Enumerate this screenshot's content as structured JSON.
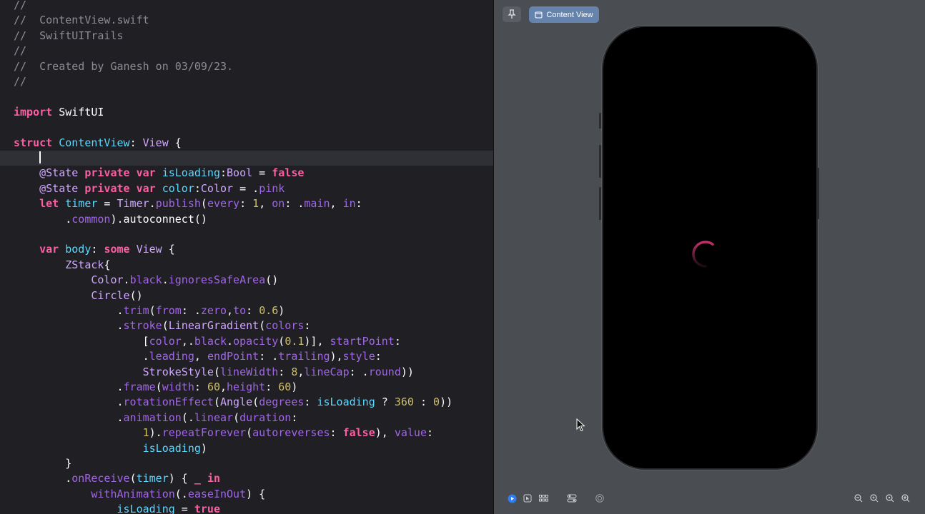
{
  "editor": {
    "lines": [
      {
        "segments": [
          [
            "c",
            "//"
          ]
        ]
      },
      {
        "segments": [
          [
            "c",
            "//  ContentView.swift"
          ]
        ]
      },
      {
        "segments": [
          [
            "c",
            "//  SwiftUITrails"
          ]
        ]
      },
      {
        "segments": [
          [
            "c",
            "//"
          ]
        ]
      },
      {
        "segments": [
          [
            "c",
            "//  Created by Ganesh on 03/09/23."
          ]
        ]
      },
      {
        "segments": [
          [
            "c",
            "//"
          ]
        ]
      },
      {
        "segments": []
      },
      {
        "segments": [
          [
            "k",
            "import"
          ],
          [
            "pl",
            " SwiftUI"
          ]
        ]
      },
      {
        "segments": []
      },
      {
        "segments": [
          [
            "k",
            "struct"
          ],
          [
            "pl",
            " "
          ],
          [
            "t",
            "ContentView"
          ],
          [
            "pl",
            ": "
          ],
          [
            "tp",
            "View"
          ],
          [
            "pl",
            " {"
          ]
        ]
      },
      {
        "segments": [
          [
            "pl",
            "    "
          ]
        ],
        "current": true
      },
      {
        "segments": [
          [
            "pl",
            "    "
          ],
          [
            "tp",
            "@State"
          ],
          [
            "pl",
            " "
          ],
          [
            "k",
            "private var"
          ],
          [
            "pl",
            " "
          ],
          [
            "t",
            "isLoading"
          ],
          [
            "pl",
            ":"
          ],
          [
            "tp",
            "Bool"
          ],
          [
            "pl",
            " = "
          ],
          [
            "k",
            "false"
          ]
        ]
      },
      {
        "segments": [
          [
            "pl",
            "    "
          ],
          [
            "tp",
            "@State"
          ],
          [
            "pl",
            " "
          ],
          [
            "k",
            "private var"
          ],
          [
            "pl",
            " "
          ],
          [
            "t",
            "color"
          ],
          [
            "pl",
            ":"
          ],
          [
            "tp",
            "Color"
          ],
          [
            "pl",
            " = ."
          ],
          [
            "pr",
            "pink"
          ]
        ]
      },
      {
        "segments": [
          [
            "pl",
            "    "
          ],
          [
            "k",
            "let"
          ],
          [
            "pl",
            " "
          ],
          [
            "t",
            "timer"
          ],
          [
            "pl",
            " = "
          ],
          [
            "tp",
            "Timer"
          ],
          [
            "pl",
            "."
          ],
          [
            "pr",
            "publish"
          ],
          [
            "pl",
            "("
          ],
          [
            "pr",
            "every"
          ],
          [
            "pl",
            ": "
          ],
          [
            "n",
            "1"
          ],
          [
            "pl",
            ", "
          ],
          [
            "pr",
            "on"
          ],
          [
            "pl",
            ": ."
          ],
          [
            "pr",
            "main"
          ],
          [
            "pl",
            ", "
          ],
          [
            "pr",
            "in"
          ],
          [
            "pl",
            ":"
          ]
        ]
      },
      {
        "segments": [
          [
            "pl",
            "        ."
          ],
          [
            "pr",
            "common"
          ],
          [
            "pl",
            ").autoconnect()"
          ]
        ]
      },
      {
        "segments": []
      },
      {
        "segments": [
          [
            "pl",
            "    "
          ],
          [
            "k",
            "var"
          ],
          [
            "pl",
            " "
          ],
          [
            "t",
            "body"
          ],
          [
            "pl",
            ": "
          ],
          [
            "k",
            "some"
          ],
          [
            "pl",
            " "
          ],
          [
            "tp",
            "View"
          ],
          [
            "pl",
            " {"
          ]
        ]
      },
      {
        "segments": [
          [
            "pl",
            "        "
          ],
          [
            "tp",
            "ZStack"
          ],
          [
            "pl",
            "{"
          ]
        ]
      },
      {
        "segments": [
          [
            "pl",
            "            "
          ],
          [
            "tp",
            "Color"
          ],
          [
            "pl",
            "."
          ],
          [
            "pr",
            "black"
          ],
          [
            "pl",
            "."
          ],
          [
            "pr",
            "ignoresSafeArea"
          ],
          [
            "pl",
            "()"
          ]
        ]
      },
      {
        "segments": [
          [
            "pl",
            "            "
          ],
          [
            "tp",
            "Circle"
          ],
          [
            "pl",
            "()"
          ]
        ]
      },
      {
        "segments": [
          [
            "pl",
            "                ."
          ],
          [
            "pr",
            "trim"
          ],
          [
            "pl",
            "("
          ],
          [
            "pr",
            "from"
          ],
          [
            "pl",
            ": ."
          ],
          [
            "pr",
            "zero"
          ],
          [
            "pl",
            ","
          ],
          [
            "pr",
            "to"
          ],
          [
            "pl",
            ": "
          ],
          [
            "n",
            "0.6"
          ],
          [
            "pl",
            ")"
          ]
        ]
      },
      {
        "segments": [
          [
            "pl",
            "                ."
          ],
          [
            "pr",
            "stroke"
          ],
          [
            "pl",
            "("
          ],
          [
            "tp",
            "LinearGradient"
          ],
          [
            "pl",
            "("
          ],
          [
            "pr",
            "colors"
          ],
          [
            "pl",
            ":"
          ]
        ]
      },
      {
        "segments": [
          [
            "pl",
            "                    ["
          ],
          [
            "pr",
            "color"
          ],
          [
            "pl",
            ",."
          ],
          [
            "pr",
            "black"
          ],
          [
            "pl",
            "."
          ],
          [
            "pr",
            "opacity"
          ],
          [
            "pl",
            "("
          ],
          [
            "n",
            "0.1"
          ],
          [
            "pl",
            ")], "
          ],
          [
            "pr",
            "startPoint"
          ],
          [
            "pl",
            ":"
          ]
        ]
      },
      {
        "segments": [
          [
            "pl",
            "                    ."
          ],
          [
            "pr",
            "leading"
          ],
          [
            "pl",
            ", "
          ],
          [
            "pr",
            "endPoint"
          ],
          [
            "pl",
            ": ."
          ],
          [
            "pr",
            "trailing"
          ],
          [
            "pl",
            "),"
          ],
          [
            "pr",
            "style"
          ],
          [
            "pl",
            ":"
          ]
        ]
      },
      {
        "segments": [
          [
            "pl",
            "                    "
          ],
          [
            "tp",
            "StrokeStyle"
          ],
          [
            "pl",
            "("
          ],
          [
            "pr",
            "lineWidth"
          ],
          [
            "pl",
            ": "
          ],
          [
            "n",
            "8"
          ],
          [
            "pl",
            ","
          ],
          [
            "pr",
            "lineCap"
          ],
          [
            "pl",
            ": ."
          ],
          [
            "pr",
            "round"
          ],
          [
            "pl",
            "))"
          ]
        ]
      },
      {
        "segments": [
          [
            "pl",
            "                ."
          ],
          [
            "pr",
            "frame"
          ],
          [
            "pl",
            "("
          ],
          [
            "pr",
            "width"
          ],
          [
            "pl",
            ": "
          ],
          [
            "n",
            "60"
          ],
          [
            "pl",
            ","
          ],
          [
            "pr",
            "height"
          ],
          [
            "pl",
            ": "
          ],
          [
            "n",
            "60"
          ],
          [
            "pl",
            ")"
          ]
        ]
      },
      {
        "segments": [
          [
            "pl",
            "                ."
          ],
          [
            "pr",
            "rotationEffect"
          ],
          [
            "pl",
            "("
          ],
          [
            "tp",
            "Angle"
          ],
          [
            "pl",
            "("
          ],
          [
            "pr",
            "degrees"
          ],
          [
            "pl",
            ": "
          ],
          [
            "t",
            "isLoading"
          ],
          [
            "pl",
            " ? "
          ],
          [
            "n",
            "360"
          ],
          [
            "pl",
            " : "
          ],
          [
            "n",
            "0"
          ],
          [
            "pl",
            "))"
          ]
        ]
      },
      {
        "segments": [
          [
            "pl",
            "                ."
          ],
          [
            "pr",
            "animation"
          ],
          [
            "pl",
            "(."
          ],
          [
            "pr",
            "linear"
          ],
          [
            "pl",
            "("
          ],
          [
            "pr",
            "duration"
          ],
          [
            "pl",
            ":"
          ]
        ]
      },
      {
        "segments": [
          [
            "pl",
            "                    "
          ],
          [
            "n",
            "1"
          ],
          [
            "pl",
            ")."
          ],
          [
            "pr",
            "repeatForever"
          ],
          [
            "pl",
            "("
          ],
          [
            "pr",
            "autoreverses"
          ],
          [
            "pl",
            ": "
          ],
          [
            "k",
            "false"
          ],
          [
            "pl",
            "), "
          ],
          [
            "pr",
            "value"
          ],
          [
            "pl",
            ":"
          ]
        ]
      },
      {
        "segments": [
          [
            "pl",
            "                    "
          ],
          [
            "t",
            "isLoading"
          ],
          [
            "pl",
            ")"
          ]
        ]
      },
      {
        "segments": [
          [
            "pl",
            "        }"
          ]
        ]
      },
      {
        "segments": [
          [
            "pl",
            "        ."
          ],
          [
            "pr",
            "onReceive"
          ],
          [
            "pl",
            "("
          ],
          [
            "t",
            "timer"
          ],
          [
            "pl",
            ") { "
          ],
          [
            "k",
            "_"
          ],
          [
            "pl",
            " "
          ],
          [
            "k",
            "in"
          ]
        ]
      },
      {
        "segments": [
          [
            "pl",
            "            "
          ],
          [
            "pr",
            "withAnimation"
          ],
          [
            "pl",
            "(."
          ],
          [
            "pr",
            "easeInOut"
          ],
          [
            "pl",
            ") {"
          ]
        ]
      },
      {
        "segments": [
          [
            "pl",
            "                "
          ],
          [
            "t",
            "isLoading"
          ],
          [
            "pl",
            " = "
          ],
          [
            "k",
            "true"
          ]
        ]
      }
    ]
  },
  "preview": {
    "canvas_label": "Content View",
    "icons": {
      "pin": "pin-icon",
      "canvas": "canvas-icon",
      "live": "play-icon",
      "selectable": "cursor-select-icon",
      "variants": "grid-icon",
      "settings": "device-settings-icon",
      "device": "device-icon",
      "zoom_out": "zoom-out-icon",
      "zoom_fit": "zoom-fit-icon",
      "zoom_actual": "zoom-actual-icon",
      "zoom_in": "zoom-in-icon"
    },
    "spinner_colors": [
      "#c0306a",
      "#1a0a12"
    ],
    "accent": "#6683ad"
  }
}
